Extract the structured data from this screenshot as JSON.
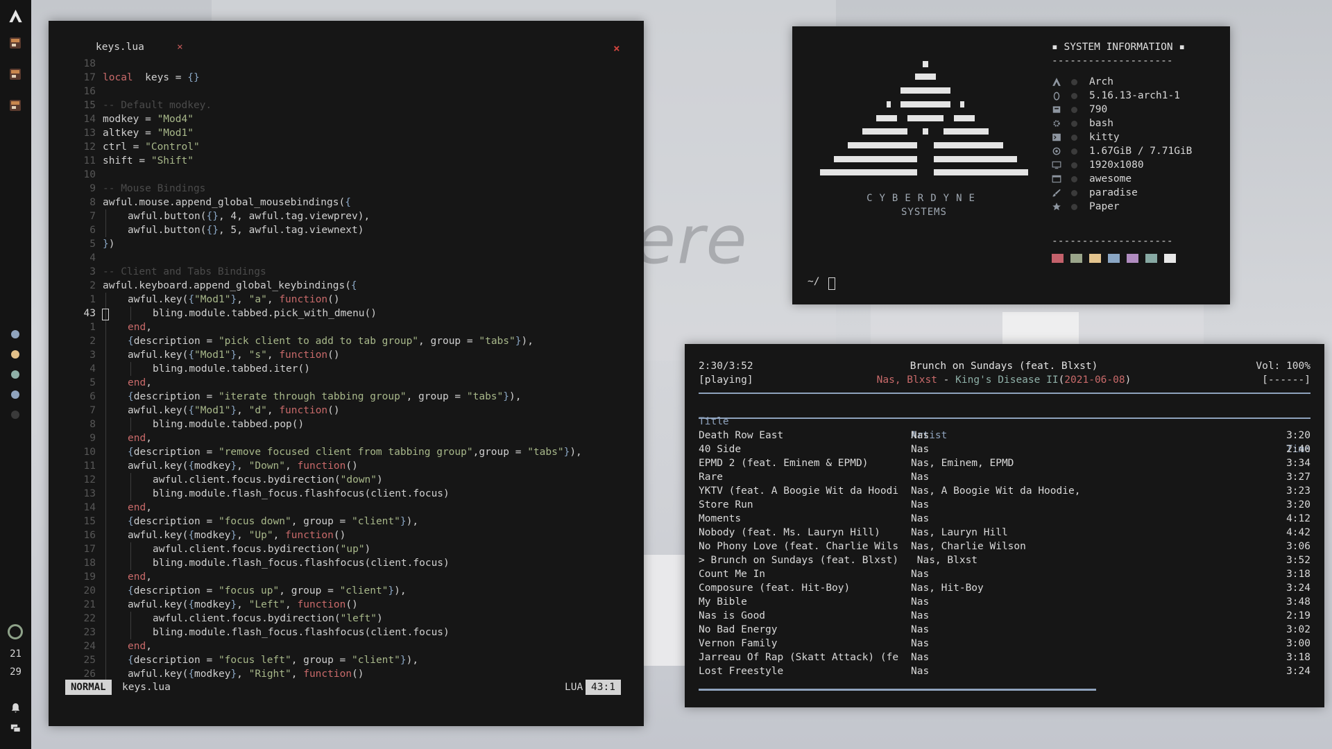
{
  "desktop": {
    "wallpaper_text": "ere"
  },
  "sidebar": {
    "apps": [
      "terminal-icon",
      "terminal-icon",
      "terminal-icon"
    ],
    "tag_colors": [
      "#8fa3bd",
      "#e2c089",
      "#8fb0a8",
      "#8fa3bd",
      "#3a3a3a"
    ],
    "clock_hour": "21",
    "clock_minute": "29"
  },
  "editor": {
    "tab_label": "keys.lua",
    "tab_close": "×",
    "window_close": "×",
    "mode": "NORMAL",
    "filename": "keys.lua",
    "filetype": "LUA",
    "position": "43:1",
    "lines": [
      {
        "n": "18",
        "cur": false,
        "indent": 0,
        "t": []
      },
      {
        "n": "17",
        "cur": false,
        "indent": 0,
        "t": [
          [
            "kw",
            "local"
          ],
          [
            "",
            "  keys = "
          ],
          [
            "brc",
            "{}"
          ]
        ]
      },
      {
        "n": "16",
        "cur": false,
        "indent": 0,
        "t": []
      },
      {
        "n": "15",
        "cur": false,
        "indent": 0,
        "t": [
          [
            "cmt",
            "-- Default modkey."
          ]
        ]
      },
      {
        "n": "14",
        "cur": false,
        "indent": 0,
        "t": [
          [
            "",
            "modkey = "
          ],
          [
            "str",
            "\"Mod4\""
          ]
        ]
      },
      {
        "n": "13",
        "cur": false,
        "indent": 0,
        "t": [
          [
            "",
            "altkey = "
          ],
          [
            "str",
            "\"Mod1\""
          ]
        ]
      },
      {
        "n": "12",
        "cur": false,
        "indent": 0,
        "t": [
          [
            "",
            "ctrl = "
          ],
          [
            "str",
            "\"Control\""
          ]
        ]
      },
      {
        "n": "11",
        "cur": false,
        "indent": 0,
        "t": [
          [
            "",
            "shift = "
          ],
          [
            "str",
            "\"Shift\""
          ]
        ]
      },
      {
        "n": "10",
        "cur": false,
        "indent": 0,
        "t": []
      },
      {
        "n": "9",
        "cur": false,
        "indent": 0,
        "t": [
          [
            "cmt",
            "-- Mouse Bindings"
          ]
        ]
      },
      {
        "n": "8",
        "cur": false,
        "indent": 0,
        "t": [
          [
            "",
            "awful.mouse.append_global_mousebindings("
          ],
          [
            "brc",
            "{"
          ]
        ]
      },
      {
        "n": "7",
        "cur": false,
        "indent": 1,
        "t": [
          [
            "",
            "awful.button("
          ],
          [
            "brc",
            "{}"
          ],
          [
            "",
            ", 4, awful.tag.viewprev),"
          ]
        ]
      },
      {
        "n": "6",
        "cur": false,
        "indent": 1,
        "t": [
          [
            "",
            "awful.button("
          ],
          [
            "brc",
            "{}"
          ],
          [
            "",
            ", 5, awful.tag.viewnext)"
          ]
        ]
      },
      {
        "n": "5",
        "cur": false,
        "indent": 0,
        "t": [
          [
            "brc",
            "}"
          ],
          [
            "",
            ")"
          ]
        ]
      },
      {
        "n": "4",
        "cur": false,
        "indent": 0,
        "t": []
      },
      {
        "n": "3",
        "cur": false,
        "indent": 0,
        "t": [
          [
            "cmt",
            "-- Client and Tabs Bindings"
          ]
        ]
      },
      {
        "n": "2",
        "cur": false,
        "indent": 0,
        "t": [
          [
            "",
            "awful.keyboard.append_global_keybindings("
          ],
          [
            "brc",
            "{"
          ]
        ]
      },
      {
        "n": "1",
        "cur": false,
        "indent": 1,
        "t": [
          [
            "",
            "awful.key("
          ],
          [
            "brc",
            "{"
          ],
          [
            "str",
            "\"Mod1\""
          ],
          [
            "brc",
            "}"
          ],
          [
            "",
            ", "
          ],
          [
            "str",
            "\"a\""
          ],
          [
            "",
            ", "
          ],
          [
            "kw",
            "function"
          ],
          [
            "",
            "()"
          ]
        ]
      },
      {
        "n": "43",
        "cur": true,
        "indent": 2,
        "t": [
          [
            "",
            "bling.module.tabbed.pick_with_dmenu()"
          ]
        ]
      },
      {
        "n": "1",
        "cur": false,
        "indent": 1,
        "t": [
          [
            "kw",
            "end"
          ],
          [
            "",
            ","
          ]
        ]
      },
      {
        "n": "2",
        "cur": false,
        "indent": 1,
        "t": [
          [
            "brc",
            "{"
          ],
          [
            "",
            "description = "
          ],
          [
            "str",
            "\"pick client to add to tab group\""
          ],
          [
            "",
            ", group = "
          ],
          [
            "str",
            "\"tabs\""
          ],
          [
            "brc",
            "}"
          ],
          [
            "",
            "),"
          ]
        ]
      },
      {
        "n": "3",
        "cur": false,
        "indent": 1,
        "t": [
          [
            "",
            "awful.key("
          ],
          [
            "brc",
            "{"
          ],
          [
            "str",
            "\"Mod1\""
          ],
          [
            "brc",
            "}"
          ],
          [
            "",
            ", "
          ],
          [
            "str",
            "\"s\""
          ],
          [
            "",
            ", "
          ],
          [
            "kw",
            "function"
          ],
          [
            "",
            "()"
          ]
        ]
      },
      {
        "n": "4",
        "cur": false,
        "indent": 2,
        "t": [
          [
            "",
            "bling.module.tabbed.iter()"
          ]
        ]
      },
      {
        "n": "5",
        "cur": false,
        "indent": 1,
        "t": [
          [
            "kw",
            "end"
          ],
          [
            "",
            ","
          ]
        ]
      },
      {
        "n": "6",
        "cur": false,
        "indent": 1,
        "t": [
          [
            "brc",
            "{"
          ],
          [
            "",
            "description = "
          ],
          [
            "str",
            "\"iterate through tabbing group\""
          ],
          [
            "",
            ", group = "
          ],
          [
            "str",
            "\"tabs\""
          ],
          [
            "brc",
            "}"
          ],
          [
            "",
            "),"
          ]
        ]
      },
      {
        "n": "7",
        "cur": false,
        "indent": 1,
        "t": [
          [
            "",
            "awful.key("
          ],
          [
            "brc",
            "{"
          ],
          [
            "str",
            "\"Mod1\""
          ],
          [
            "brc",
            "}"
          ],
          [
            "",
            ", "
          ],
          [
            "str",
            "\"d\""
          ],
          [
            "",
            ", "
          ],
          [
            "kw",
            "function"
          ],
          [
            "",
            "()"
          ]
        ]
      },
      {
        "n": "8",
        "cur": false,
        "indent": 2,
        "t": [
          [
            "",
            "bling.module.tabbed.pop()"
          ]
        ]
      },
      {
        "n": "9",
        "cur": false,
        "indent": 1,
        "t": [
          [
            "kw",
            "end"
          ],
          [
            "",
            ","
          ]
        ]
      },
      {
        "n": "10",
        "cur": false,
        "indent": 1,
        "t": [
          [
            "brc",
            "{"
          ],
          [
            "",
            "description = "
          ],
          [
            "str",
            "\"remove focused client from tabbing group\""
          ],
          [
            "",
            ",group = "
          ],
          [
            "str",
            "\"tabs\""
          ],
          [
            "brc",
            "}"
          ],
          [
            "",
            "),"
          ]
        ]
      },
      {
        "n": "11",
        "cur": false,
        "indent": 1,
        "t": [
          [
            "",
            "awful.key("
          ],
          [
            "brc",
            "{"
          ],
          [
            "",
            "modkey"
          ],
          [
            "brc",
            "}"
          ],
          [
            "",
            ", "
          ],
          [
            "str",
            "\"Down\""
          ],
          [
            "",
            ", "
          ],
          [
            "kw",
            "function"
          ],
          [
            "",
            "()"
          ]
        ]
      },
      {
        "n": "12",
        "cur": false,
        "indent": 2,
        "t": [
          [
            "",
            "awful.client.focus.bydirection("
          ],
          [
            "str",
            "\"down\""
          ],
          [
            "",
            ")"
          ]
        ]
      },
      {
        "n": "13",
        "cur": false,
        "indent": 2,
        "t": [
          [
            "",
            "bling.module.flash_focus.flashfocus(client.focus)"
          ]
        ]
      },
      {
        "n": "14",
        "cur": false,
        "indent": 1,
        "t": [
          [
            "kw",
            "end"
          ],
          [
            "",
            ","
          ]
        ]
      },
      {
        "n": "15",
        "cur": false,
        "indent": 1,
        "t": [
          [
            "brc",
            "{"
          ],
          [
            "",
            "description = "
          ],
          [
            "str",
            "\"focus down\""
          ],
          [
            "",
            ", group = "
          ],
          [
            "str",
            "\"client\""
          ],
          [
            "brc",
            "}"
          ],
          [
            "",
            "),"
          ]
        ]
      },
      {
        "n": "16",
        "cur": false,
        "indent": 1,
        "t": [
          [
            "",
            "awful.key("
          ],
          [
            "brc",
            "{"
          ],
          [
            "",
            "modkey"
          ],
          [
            "brc",
            "}"
          ],
          [
            "",
            ", "
          ],
          [
            "str",
            "\"Up\""
          ],
          [
            "",
            ", "
          ],
          [
            "kw",
            "function"
          ],
          [
            "",
            "()"
          ]
        ]
      },
      {
        "n": "17",
        "cur": false,
        "indent": 2,
        "t": [
          [
            "",
            "awful.client.focus.bydirection("
          ],
          [
            "str",
            "\"up\""
          ],
          [
            "",
            ")"
          ]
        ]
      },
      {
        "n": "18",
        "cur": false,
        "indent": 2,
        "t": [
          [
            "",
            "bling.module.flash_focus.flashfocus(client.focus)"
          ]
        ]
      },
      {
        "n": "19",
        "cur": false,
        "indent": 1,
        "t": [
          [
            "kw",
            "end"
          ],
          [
            "",
            ","
          ]
        ]
      },
      {
        "n": "20",
        "cur": false,
        "indent": 1,
        "t": [
          [
            "brc",
            "{"
          ],
          [
            "",
            "description = "
          ],
          [
            "str",
            "\"focus up\""
          ],
          [
            "",
            ", group = "
          ],
          [
            "str",
            "\"client\""
          ],
          [
            "brc",
            "}"
          ],
          [
            "",
            "),"
          ]
        ]
      },
      {
        "n": "21",
        "cur": false,
        "indent": 1,
        "t": [
          [
            "",
            "awful.key("
          ],
          [
            "brc",
            "{"
          ],
          [
            "",
            "modkey"
          ],
          [
            "brc",
            "}"
          ],
          [
            "",
            ", "
          ],
          [
            "str",
            "\"Left\""
          ],
          [
            "",
            ", "
          ],
          [
            "kw",
            "function"
          ],
          [
            "",
            "()"
          ]
        ]
      },
      {
        "n": "22",
        "cur": false,
        "indent": 2,
        "t": [
          [
            "",
            "awful.client.focus.bydirection("
          ],
          [
            "str",
            "\"left\""
          ],
          [
            "",
            ")"
          ]
        ]
      },
      {
        "n": "23",
        "cur": false,
        "indent": 2,
        "t": [
          [
            "",
            "bling.module.flash_focus.flashfocus(client.focus)"
          ]
        ]
      },
      {
        "n": "24",
        "cur": false,
        "indent": 1,
        "t": [
          [
            "kw",
            "end"
          ],
          [
            "",
            ","
          ]
        ]
      },
      {
        "n": "25",
        "cur": false,
        "indent": 1,
        "t": [
          [
            "brc",
            "{"
          ],
          [
            "",
            "description = "
          ],
          [
            "str",
            "\"focus left\""
          ],
          [
            "",
            ", group = "
          ],
          [
            "str",
            "\"client\""
          ],
          [
            "brc",
            "}"
          ],
          [
            "",
            "),"
          ]
        ]
      },
      {
        "n": "26",
        "cur": false,
        "indent": 1,
        "t": [
          [
            "",
            "awful.key("
          ],
          [
            "brc",
            "{"
          ],
          [
            "",
            "modkey"
          ],
          [
            "brc",
            "}"
          ],
          [
            "",
            ", "
          ],
          [
            "str",
            "\"Right\""
          ],
          [
            "",
            ", "
          ],
          [
            "kw",
            "function"
          ],
          [
            "",
            "()"
          ]
        ]
      }
    ]
  },
  "sysinfo": {
    "logo_title": "CYBERDYNE",
    "logo_subtitle": "SYSTEMS",
    "title": "▪ SYSTEM INFORMATION ▪",
    "separator": "--------------------",
    "rows": [
      {
        "icon": "arch-icon",
        "value": "Arch"
      },
      {
        "icon": "linux-icon",
        "value": "5.16.13-arch1-1"
      },
      {
        "icon": "package-icon",
        "value": "790"
      },
      {
        "icon": "gear-icon",
        "value": "bash"
      },
      {
        "icon": "terminal-icon",
        "value": "kitty"
      },
      {
        "icon": "memory-icon",
        "value": "1.67GiB / 7.71GiB"
      },
      {
        "icon": "monitor-icon",
        "value": "1920x1080"
      },
      {
        "icon": "window-icon",
        "value": "awesome"
      },
      {
        "icon": "brush-icon",
        "value": "paradise"
      },
      {
        "icon": "star-icon",
        "value": "Paper"
      }
    ],
    "palette": [
      "#c4616b",
      "#9aa58a",
      "#e3c48e",
      "#8aa6c4",
      "#b08cc0",
      "#87a9a3",
      "#e8e8e8"
    ],
    "prompt": "~/"
  },
  "music": {
    "elapsed": "2:30/3:52",
    "state": "[playing]",
    "song_title": "Brunch on Sundays (feat. Blxst)",
    "artists": "Nas, Blxst",
    "dash": " - ",
    "album": "King's Disease II",
    "paren_open": "(",
    "date": "2021-06-08",
    "paren_close": ")",
    "volume": "Vol: 100%",
    "flags": "[------]",
    "columns": {
      "title": "Title",
      "artist": "Artist",
      "time": "Time"
    },
    "progress": 0.65,
    "tracks": [
      {
        "title": "Death Row East",
        "artist": "Nas",
        "time": "3:20"
      },
      {
        "title": "40 Side",
        "artist": "Nas",
        "time": "2:40"
      },
      {
        "title": "EPMD 2 (feat. Eminem & EPMD)",
        "artist": "Nas, Eminem, EPMD",
        "time": "3:34"
      },
      {
        "title": "Rare",
        "artist": "Nas",
        "time": "3:27"
      },
      {
        "title": "YKTV (feat. A Boogie Wit da Hoodi",
        "artist": "Nas, A Boogie Wit da Hoodie,",
        "time": "3:23"
      },
      {
        "title": "Store Run",
        "artist": "Nas",
        "time": "3:20"
      },
      {
        "title": "Moments",
        "artist": "Nas",
        "time": "4:12"
      },
      {
        "title": "Nobody (feat. Ms. Lauryn Hill)",
        "artist": "Nas, Lauryn Hill",
        "time": "4:42"
      },
      {
        "title": "No Phony Love (feat. Charlie Wils",
        "artist": "Nas, Charlie Wilson",
        "time": "3:06"
      },
      {
        "title": "> Brunch on Sundays (feat. Blxst)",
        "artist": " Nas, Blxst",
        "time": "3:52"
      },
      {
        "title": "Count Me In",
        "artist": "Nas",
        "time": "3:18"
      },
      {
        "title": "Composure (feat. Hit-Boy)",
        "artist": "Nas, Hit-Boy",
        "time": "3:24"
      },
      {
        "title": "My Bible",
        "artist": "Nas",
        "time": "3:48"
      },
      {
        "title": "Nas is Good",
        "artist": "Nas",
        "time": "2:19"
      },
      {
        "title": "No Bad Energy",
        "artist": "Nas",
        "time": "3:02"
      },
      {
        "title": "Vernon Family",
        "artist": "Nas",
        "time": "3:00"
      },
      {
        "title": "Jarreau Of Rap (Skatt Attack) (fe",
        "artist": "Nas",
        "time": "3:18"
      },
      {
        "title": "Lost Freestyle",
        "artist": "Nas",
        "time": "3:24"
      }
    ]
  }
}
